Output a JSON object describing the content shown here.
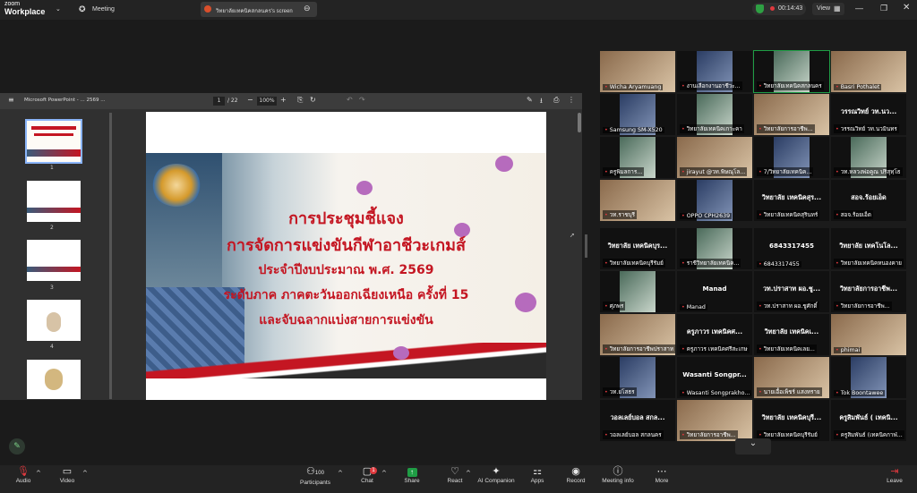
{
  "app": {
    "logo_line1": "zoom",
    "logo_line2": "Workplace",
    "meeting_label": "Meeting"
  },
  "share": {
    "tab_title": "วิทยาลัยเทคนิคสกลนคร's screen"
  },
  "status": {
    "timer": "00:14:43",
    "view_label": "View"
  },
  "pdf": {
    "title": "Microsoft PowerPoint - ... 2569 ...",
    "page_current": "1",
    "page_total": "/ 22",
    "zoom": "100%",
    "thumb_numbers": [
      "1",
      "2",
      "3",
      "4"
    ]
  },
  "slide": {
    "line1": "การประชุมชี้แจง",
    "line2": "การจัดการแข่งขันกีฬาอาชีวะเกมส์",
    "line3": "ประจำปีงบประมาณ พ.ศ. 2569",
    "line4": "ระดับภาค ภาคตะวันออกเฉียงเหนือ ครั้งที่ 15",
    "line5": "และจับฉลากแบ่งสายการแข่งขัน"
  },
  "participants": [
    {
      "name": "Wicha Aryamuang",
      "big": ""
    },
    {
      "name": "งานเลือกงานอาชีวะ...",
      "big": ""
    },
    {
      "name": "วิทยาลัยเทคนิคสกลนคร",
      "big": ""
    },
    {
      "name": "Basri Pothalet",
      "big": ""
    },
    {
      "name": "Samsung SM-X520",
      "big": ""
    },
    {
      "name": "วิทยาลัยเทคนิคเกาะคา",
      "big": ""
    },
    {
      "name": "วิทยาลัยการอาชีพ...",
      "big": ""
    },
    {
      "name": "วรรณวิทย์ วท.นวมินทร",
      "big": "วรรณวิทย์ วท.นว..."
    },
    {
      "name": "ครูพิมลการ...",
      "big": ""
    },
    {
      "name": "jirayut @วท.พิษณุโล...",
      "big": "jirayut @วท.พิ..."
    },
    {
      "name": "7/วิทยาลัยเทคนิค...",
      "big": ""
    },
    {
      "name": "วท.หลวงพ่อคูณ ปริสุทฺโธ",
      "big": ""
    },
    {
      "name": "วท.ราชบุรี",
      "big": ""
    },
    {
      "name": "OPPO CPH2639",
      "big": ""
    },
    {
      "name": "วิทยาลัยเทคนิคสุรินทร์",
      "big": "วิทยาลัย เทคนิคสุร..."
    },
    {
      "name": "สอจ.ร้อยเอ็ด",
      "big": "สอจ.ร้อยเอ็ด"
    },
    {
      "name": "วิทยาลัยเทคนิคบุรีรัมย์",
      "big": "วิทยาลัย เทคนิคบุร..."
    },
    {
      "name": "ราชีวิทยาลัยเทคนิค...",
      "big": ""
    },
    {
      "name": "6843317455",
      "big": "6843317455"
    },
    {
      "name": "วิทยาลัยเทคนิคหนองคาย",
      "big": "วิทยาลัย เทคโนโล..."
    },
    {
      "name": "ศุภพร",
      "big": ""
    },
    {
      "name": "Manad",
      "big": "Manad"
    },
    {
      "name": "วท.ปราสาท ผอ.ชูศักดิ์",
      "big": "วท.ปราสาท ผอ.ชู..."
    },
    {
      "name": "วิทยาลัยการอาชีพ...",
      "big": "วิทยาลัยการอาชีพ..."
    },
    {
      "name": "วิทยาลัยการอาชีพปราสาท",
      "big": ""
    },
    {
      "name": "ครูภาวร เทคนิคศรีสะเกษ",
      "big": "ครูภาวร เทคนิคศ..."
    },
    {
      "name": "วิทยาลัยเทคนิคเลย...",
      "big": "วิทยาลัย เทคนิคเ..."
    },
    {
      "name": "phimai",
      "big": ""
    },
    {
      "name": "วท.ยโสธร",
      "big": ""
    },
    {
      "name": "Wasanti Songprakho...",
      "big": "Wasanti Songpr..."
    },
    {
      "name": "นายเอื้อเพ็ชร์ แสงทราย",
      "big": ""
    },
    {
      "name": "Tok Boontawee",
      "big": ""
    },
    {
      "name": "วอลเลย์บอล สกลนคร",
      "big": "วอลเลย์บอล สกล..."
    },
    {
      "name": "วิทยาลัยการอาชีพ...",
      "big": ""
    },
    {
      "name": "วิทยาลัยเทคนิคบุรีรัมย์",
      "big": "วิทยาลัย เทคนิคบุรี..."
    },
    {
      "name": "ครูสิมพันธ์ (เทคนิคกาฬ...",
      "big": "ครูสิมพันธ์ ( เทคนิ..."
    }
  ],
  "toolbar": {
    "audio": "Audio",
    "video": "Video",
    "participants": "Participants",
    "participants_count": "100",
    "chat": "Chat",
    "chat_badge": "1",
    "share": "Share",
    "react": "React",
    "ai": "AI Companion",
    "apps": "Apps",
    "record": "Record",
    "info": "Meeting info",
    "more": "More",
    "leave": "Leave"
  },
  "colors": {
    "accent_green": "#1f9d45",
    "leave_red": "#d93b3b",
    "slide_red": "#c41622"
  }
}
